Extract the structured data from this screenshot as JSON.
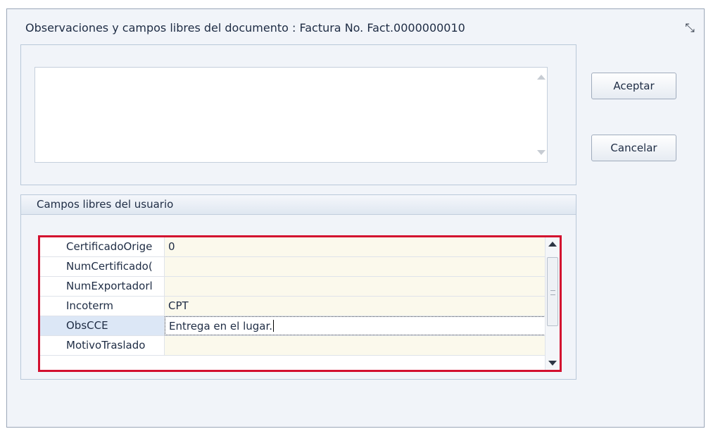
{
  "dialog": {
    "title": "Observaciones y campos libres del documento : Factura No. Fact.0000000010",
    "close_icon": "close-icon"
  },
  "observations": {
    "value": ""
  },
  "buttons": {
    "accept_label": "Aceptar",
    "cancel_label": "Cancelar"
  },
  "fields_section": {
    "title": "Campos libres del usuario",
    "rows": [
      {
        "label": "CertificadoOrige",
        "value": "0"
      },
      {
        "label": "NumCertificado(",
        "value": ""
      },
      {
        "label": "NumExportadorl",
        "value": ""
      },
      {
        "label": "Incoterm",
        "value": "CPT"
      },
      {
        "label": "ObsCCE",
        "value": "Entrega en el lugar."
      },
      {
        "label": "MotivoTraslado",
        "value": ""
      }
    ]
  },
  "colors": {
    "highlight_border": "#d3102f",
    "value_cell_bg": "#fbf9ec"
  }
}
